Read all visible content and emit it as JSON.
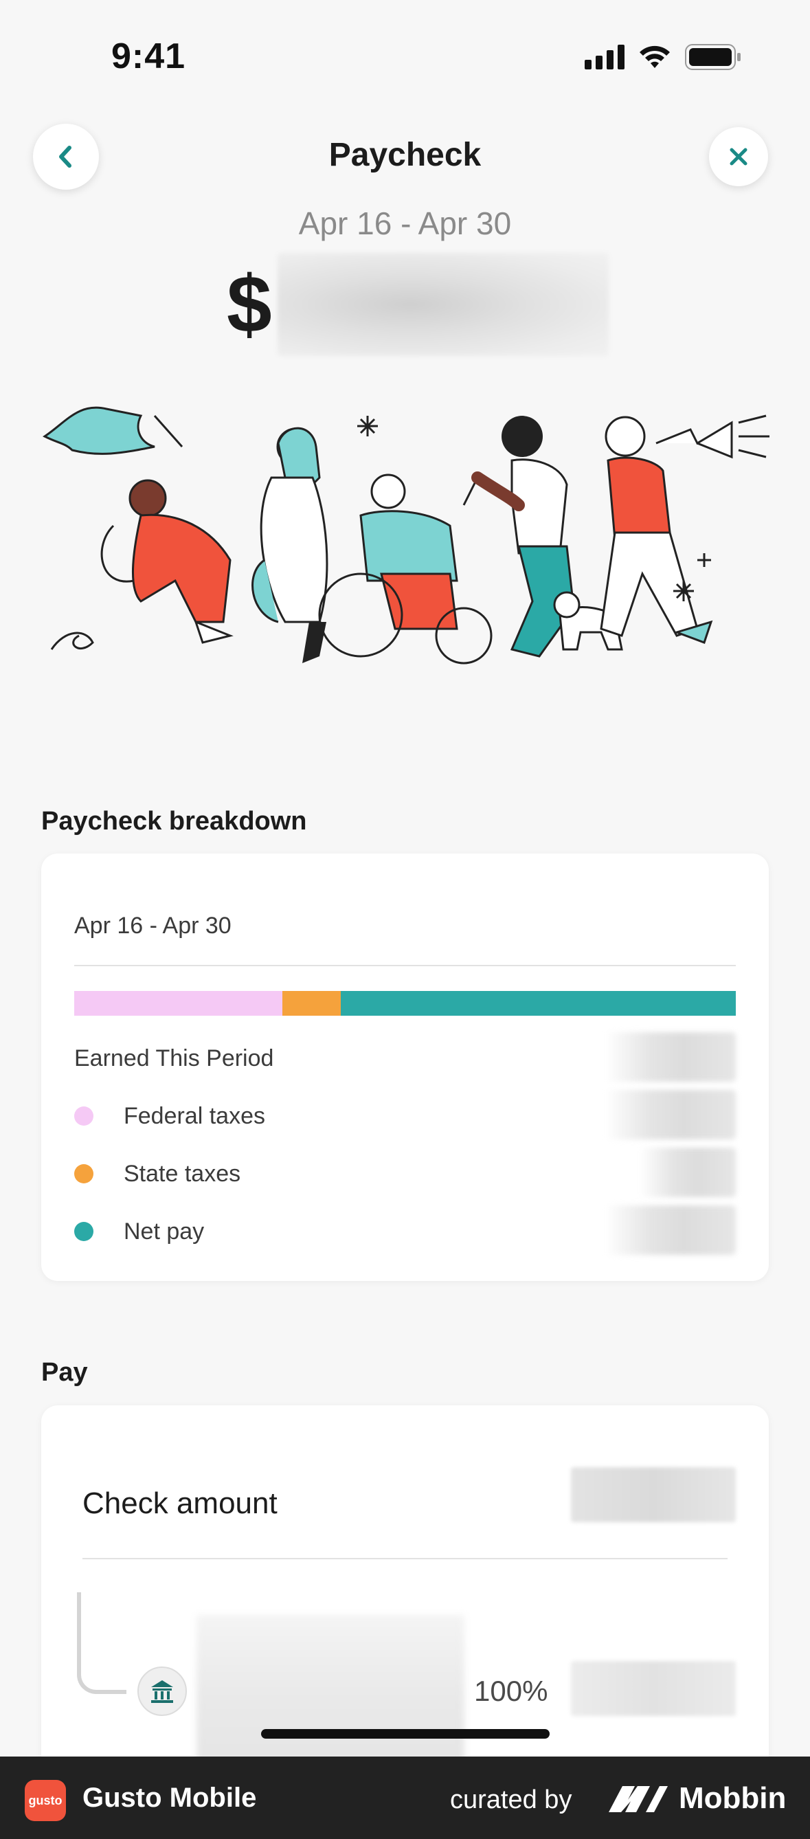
{
  "status_bar": {
    "time": "9:41"
  },
  "header": {
    "title": "Paycheck"
  },
  "summary": {
    "period": "Apr 16 - Apr 30",
    "currency_symbol": "$"
  },
  "breakdown": {
    "heading": "Paycheck breakdown",
    "period": "Apr 16 - Apr 30",
    "bar_segments": [
      {
        "name": "Federal taxes",
        "fraction": 0.315,
        "color": "#f5c9f5"
      },
      {
        "name": "State taxes",
        "fraction": 0.088,
        "color": "#f5a23c"
      },
      {
        "name": "Net pay",
        "fraction": 0.597,
        "color": "#2ba9a6"
      }
    ],
    "earned_label": "Earned This Period",
    "items": [
      {
        "label": "Federal taxes",
        "color": "#f5c9f5"
      },
      {
        "label": "State taxes",
        "color": "#f5a23c"
      },
      {
        "label": "Net pay",
        "color": "#2ba9a6"
      }
    ]
  },
  "pay": {
    "heading": "Pay",
    "check_amount_label": "Check amount",
    "percent": "100%"
  },
  "footer": {
    "app_logo_text": "gusto",
    "app_name": "Gusto Mobile",
    "curated_by": "curated by",
    "brand": "Mobbin"
  },
  "colors": {
    "accent": "#1a8a86",
    "teal": "#2ba9a6",
    "coral": "#f0533c"
  },
  "icons": [
    "back-chevron-icon",
    "close-icon",
    "bank-icon",
    "signal-icon",
    "wifi-icon",
    "battery-icon"
  ]
}
